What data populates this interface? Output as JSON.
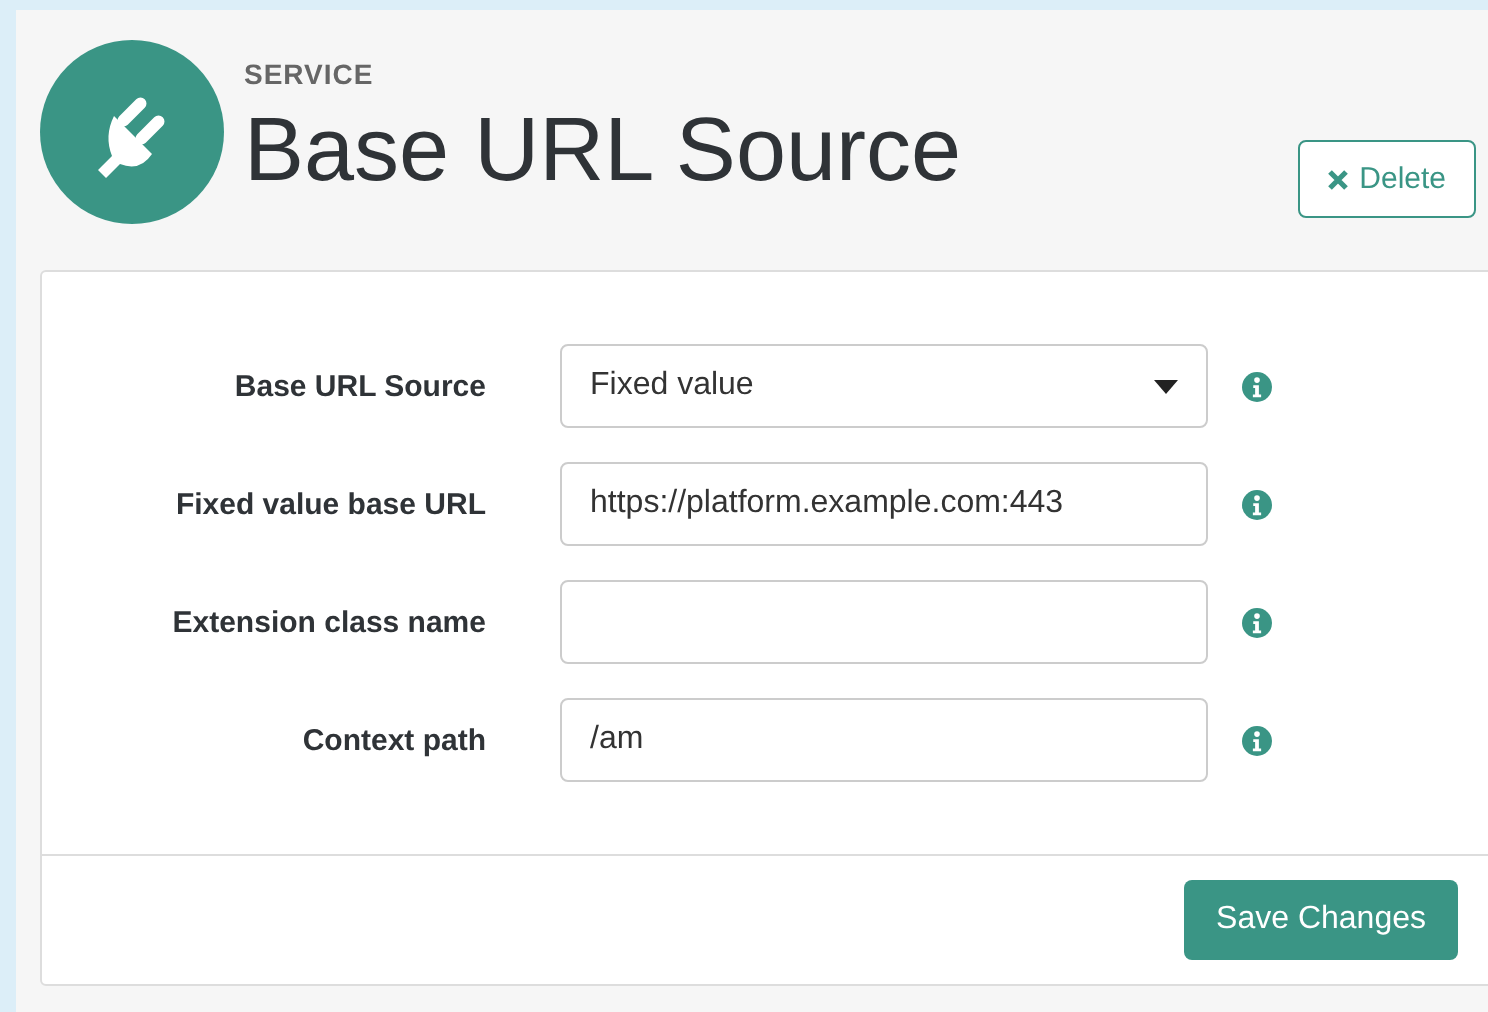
{
  "header": {
    "eyebrow": "SERVICE",
    "title": "Base URL Source",
    "delete_button": "Delete"
  },
  "fields": [
    {
      "kind": "select",
      "label": "Base URL Source",
      "value": "Fixed value"
    },
    {
      "kind": "text",
      "label": "Fixed value base URL",
      "value": "https://platform.example.com:443"
    },
    {
      "kind": "text",
      "label": "Extension class name"
    },
    {
      "kind": "text",
      "label": "Context path",
      "value": "/am"
    }
  ],
  "save_button": "Save Changes"
}
